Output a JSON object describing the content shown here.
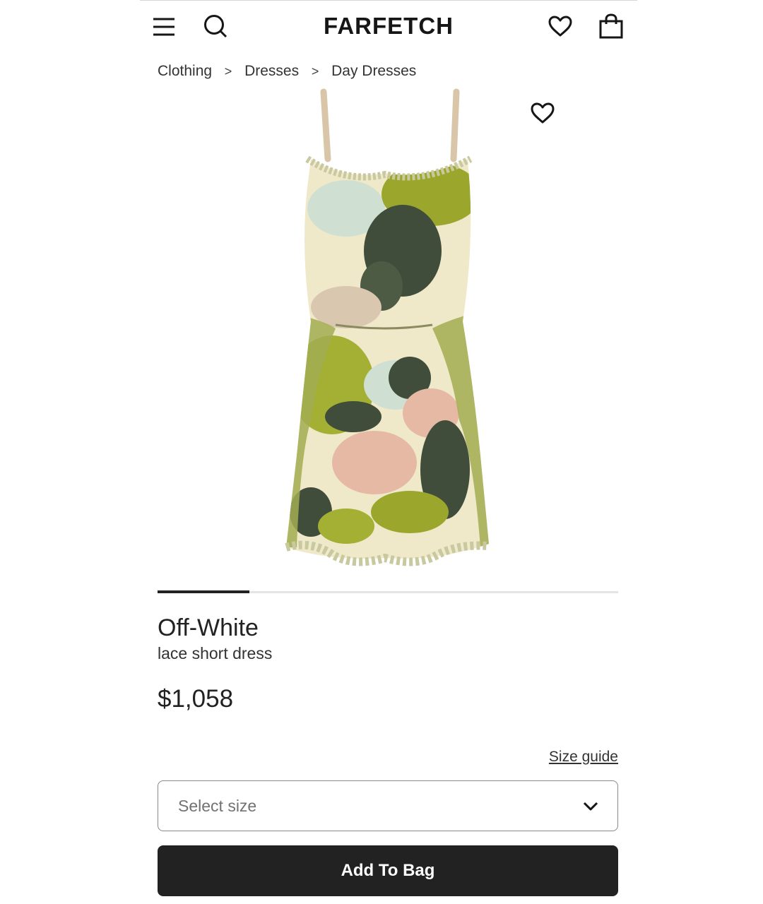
{
  "header": {
    "logo": "FARFETCH",
    "icons": [
      "hamburger-menu-icon",
      "search-icon",
      "wishlist-heart-icon",
      "shopping-bag-icon"
    ]
  },
  "breadcrumb": {
    "items": [
      "Clothing",
      "Dresses",
      "Day Dresses"
    ],
    "separator": ">"
  },
  "gallery": {
    "image_alt": "lace short dress",
    "progress": 0.2
  },
  "product": {
    "brand": "Off-White",
    "name": "lace short dress",
    "price": "$1,058"
  },
  "size": {
    "guide_label": "Size guide",
    "select_placeholder": "Select size"
  },
  "cta": {
    "add_to_bag": "Add To Bag"
  },
  "colors": {
    "text": "#222222",
    "button_bg": "#222222",
    "button_text": "#ffffff",
    "border": "#888888",
    "dress_green": "#8fa12e",
    "dress_dark": "#3f4d3a",
    "dress_cream": "#efe9c9",
    "dress_pink": "#e6b9a4"
  }
}
